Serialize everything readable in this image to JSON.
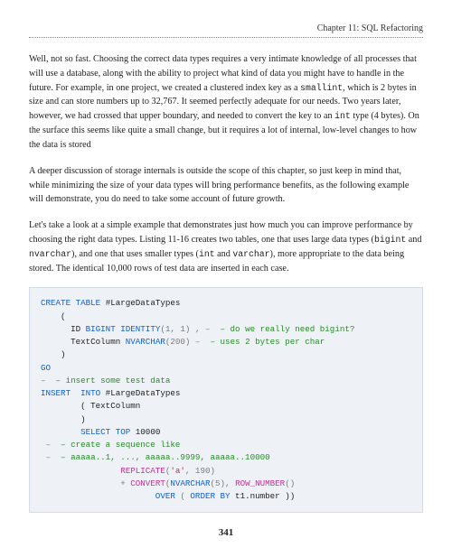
{
  "header": {
    "chapter_label": "Chapter 11: SQL Refactoring"
  },
  "paragraphs": {
    "p1_a": "Well, not so fast. Choosing the correct data types requires a very intimate knowledge of all processes that will use a database, along with the ability to project what kind of data you might have to handle in the future. For example, in one project, we created a clustered index key as a ",
    "p1_code1": "smallint",
    "p1_b": ", which is 2 bytes in size and can store numbers up to 32,767. It seemed perfectly adequate for our needs. Two years later, however, we had crossed that upper boundary, and needed to convert the key to an ",
    "p1_code2": "int",
    "p1_c": " type (4 bytes). On the surface this seems like quite a small change, but it requires a lot of internal, low-level changes to how the data is stored",
    "p2": "A deeper discussion of storage internals is outside the scope of this chapter, so just keep in mind that, while minimizing the size of your data types will bring performance benefits, as the following example will demonstrate, you do need to take some account of future growth.",
    "p3_a": "Let's take a look at a simple example that demonstrates just how much you can improve performance by choosing the right data types. Listing 11-16 creates two tables, one that uses large data types (",
    "p3_code1": "bigint",
    "p3_b": " and ",
    "p3_code2": "nvarchar",
    "p3_c": "), and one that uses smaller types (",
    "p3_code3": "int",
    "p3_d": " and ",
    "p3_code4": "varchar",
    "p3_e": "), more appropriate to the data being stored. The identical 10,000 rows of test data are inserted in each case."
  },
  "code": {
    "l01_a": "CREATE",
    "l01_b": " TABLE",
    "l01_c": " #LargeDataTypes",
    "l02": "    (",
    "l03_a": "      ID ",
    "l03_b": "BIGINT",
    "l03_c": " IDENTITY",
    "l03_d": "(1, 1) ,",
    "l03_e": " – ",
    "l03_f": " – do we really need bigint?",
    "l04_a": "      TextColumn ",
    "l04_b": "NVARCHAR",
    "l04_c": "(200)",
    "l04_d": " – ",
    "l04_e": " – uses 2 bytes per char",
    "l05": "    )",
    "l06": "GO",
    "l07_a": "– ",
    "l07_b": " – insert some test data",
    "l08_a": "INSERT  ",
    "l08_b": "INTO",
    "l08_c": " #LargeDataTypes",
    "l09": "        ( TextColumn",
    "l10": "        )",
    "l11_a": "        SELECT",
    "l11_b": " TOP",
    "l11_c": " 10000",
    "l12_a": " – ",
    "l12_b": " – create a sequence like",
    "l13_a": " – ",
    "l13_b": " – aaaaa..1, ..., aaaaa..9999, aaaaa..10000",
    "l14_a": "                REPLICATE",
    "l14_b": "(",
    "l14_c": "'a'",
    "l14_d": ", 190)",
    "l15_a": "                + ",
    "l15_b": "CONVERT",
    "l15_c": "(",
    "l15_d": "NVARCHAR",
    "l15_e": "(5), ",
    "l15_f": "ROW_NUMBER",
    "l15_g": "()",
    "l16_a": "                       OVER",
    "l16_b": " ( ",
    "l16_c": "ORDER",
    "l16_d": " BY",
    "l16_e": " t1.number ))"
  },
  "footer": {
    "page_number": "341"
  }
}
